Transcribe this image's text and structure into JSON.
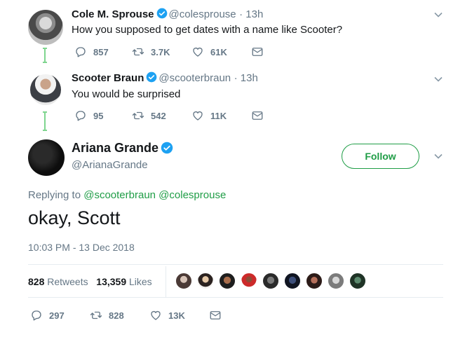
{
  "tweets": [
    {
      "name": "Cole M. Sprouse",
      "handle": "@colesprouse",
      "time": "· 13h",
      "text": "How you supposed to get dates with a name like Scooter?",
      "replies": "857",
      "retweets": "3.7K",
      "likes": "61K"
    },
    {
      "name": "Scooter Braun",
      "handle": "@scooterbraun",
      "time": "· 13h",
      "text": "You would be surprised",
      "replies": "95",
      "retweets": "542",
      "likes": "11K"
    }
  ],
  "main_tweet": {
    "name": "Ariana Grande",
    "handle": "@ArianaGrande",
    "follow_label": "Follow",
    "replying_prefix": "Replying to",
    "replying_to_1": "@scooterbraun",
    "replying_to_2": "@colesprouse",
    "text": "okay, Scott",
    "timestamp": "10:03 PM - 13 Dec 2018",
    "retweet_count": "828",
    "retweet_label": "Retweets",
    "like_count": "13,359",
    "like_label": "Likes",
    "replies": "297",
    "retweets": "828",
    "likes": "13K"
  },
  "colors": {
    "accent": "#1f9d46",
    "verified": "#1da1f2",
    "thread_line": "#7fd58f",
    "muted": "#657786"
  },
  "icons": [
    "verified-badge-icon",
    "reply-icon",
    "retweet-icon",
    "like-icon",
    "message-icon",
    "chevron-down-icon"
  ]
}
